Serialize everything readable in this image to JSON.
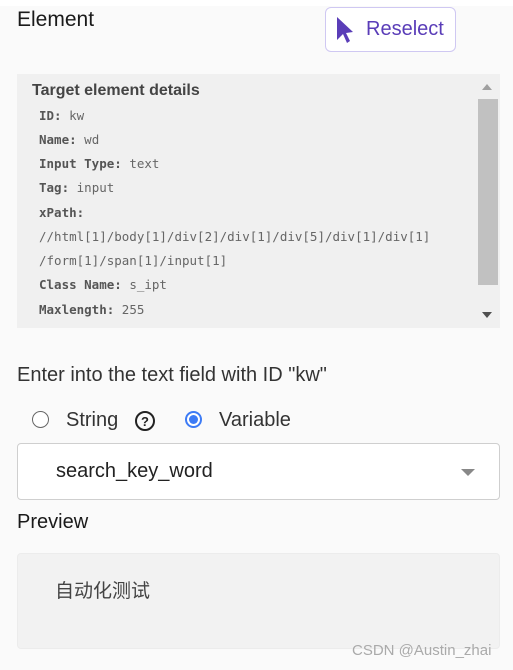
{
  "header": {
    "title": "Element",
    "reselect_label": "Reselect",
    "reselect_icon": "cursor-arrow-icon",
    "accent": "#5a3db8"
  },
  "details": {
    "title": "Target element details",
    "rows": [
      {
        "label": "ID:",
        "value": "kw"
      },
      {
        "label": "Name:",
        "value": "wd"
      },
      {
        "label": "Input Type:",
        "value": "text"
      },
      {
        "label": "Tag:",
        "value": "input"
      },
      {
        "label": "xPath:",
        "value": ""
      },
      {
        "label": "",
        "value": "//html[1]/body[1]/div[2]/div[1]/div[5]/div[1]/div[1]"
      },
      {
        "label": "",
        "value": "/form[1]/span[1]/input[1]"
      },
      {
        "label": "Class Name:",
        "value": "s_ipt"
      },
      {
        "label": "Maxlength:",
        "value": "255"
      }
    ]
  },
  "action": {
    "heading": "Enter into the text field with ID \"kw\"",
    "options": [
      {
        "label": "String",
        "selected": false
      },
      {
        "label": "Variable",
        "selected": true
      }
    ],
    "help_icon": "?",
    "variable_value": "search_key_word"
  },
  "preview": {
    "label": "Preview",
    "value": "自动化测试"
  },
  "watermark": "CSDN @Austin_zhai"
}
